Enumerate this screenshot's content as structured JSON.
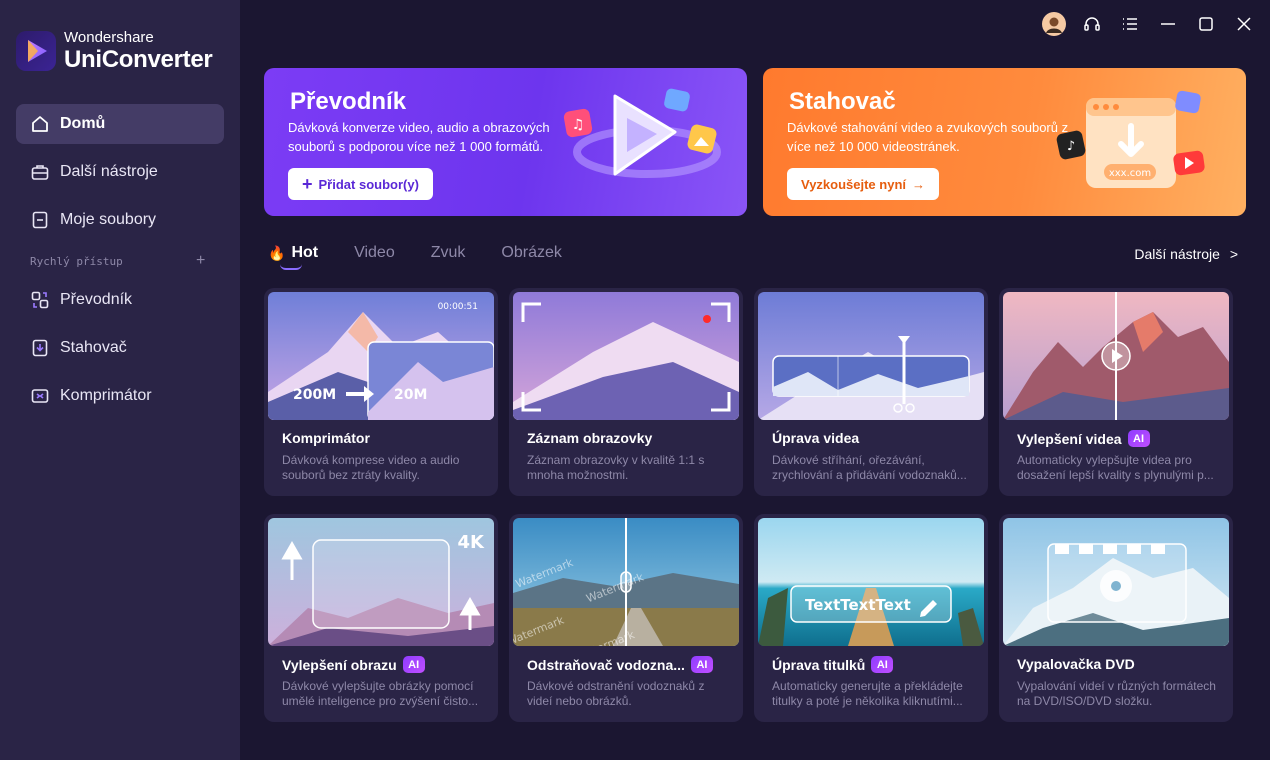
{
  "app": {
    "brand_top": "Wondershare",
    "brand_name": "UniConverter"
  },
  "sidebar": {
    "items": [
      {
        "label": "Domů",
        "icon": "home-icon"
      },
      {
        "label": "Další nástroje",
        "icon": "toolbox-icon"
      },
      {
        "label": "Moje soubory",
        "icon": "files-icon"
      }
    ],
    "quick_access_label": "Rychlý přístup",
    "quick_items": [
      {
        "label": "Převodník",
        "icon": "converter-icon"
      },
      {
        "label": "Stahovač",
        "icon": "downloader-icon"
      },
      {
        "label": "Komprimátor",
        "icon": "compressor-icon"
      }
    ]
  },
  "banners": {
    "converter": {
      "title": "Převodník",
      "desc": "Dávková konverze video, audio a obrazových souborů s podporou více než 1 000 formátů.",
      "cta": "Přidat soubor(y)"
    },
    "downloader": {
      "title": "Stahovač",
      "desc": "Dávkové stahování video a zvukových souborů z více než 10 000 videostránek.",
      "cta": "Vyzkoušejte nyní",
      "art_label": "xxx.com"
    }
  },
  "tabs": [
    "Hot",
    "Video",
    "Zvuk",
    "Obrázek"
  ],
  "more_tools": "Další nástroje",
  "cards": [
    {
      "title": "Komprimátor",
      "ai": false,
      "desc": "Dávková komprese video a audio souborů bez ztráty kvality.",
      "thumb": {
        "time": "00:00:51",
        "from": "200M",
        "to": "20M"
      }
    },
    {
      "title": "Záznam obrazovky",
      "ai": false,
      "desc": "Záznam obrazovky v kvalitě 1:1 s mnoha možnostmi."
    },
    {
      "title": "Úprava videa",
      "ai": false,
      "desc": "Dávkové stříhání, ořezávání, zrychlování a přidávání vodoznaků..."
    },
    {
      "title": "Vylepšení videa",
      "ai": true,
      "desc": "Automaticky vylepšujte videa pro dosažení lepší kvality s plynulými p..."
    },
    {
      "title": "Vylepšení obrazu",
      "ai": true,
      "desc": "Dávkové vylepšujte obrázky pomocí umělé inteligence pro zvýšení čisto...",
      "thumb": {
        "badge": "4K"
      }
    },
    {
      "title": "Odstraňovač vodozna...",
      "ai": true,
      "desc": "Dávkové odstranění vodoznaků z videí nebo obrázků.",
      "thumb": {
        "watermark": "Watermark"
      }
    },
    {
      "title": "Úprava titulků",
      "ai": true,
      "desc": "Automaticky generujte a překládejte titulky a poté je několika kliknutími...",
      "thumb": {
        "caption": "TextTextText"
      }
    },
    {
      "title": "Vypalovačka DVD",
      "ai": false,
      "desc": "Vypalování videí v různých formátech na DVD/ISO/DVD složku."
    }
  ],
  "ai_badge": "AI",
  "colors": {
    "sidebar": "#2a2446",
    "background": "#1b1631",
    "accent": "#7c3cf5",
    "orange": "#ff7a2e"
  }
}
